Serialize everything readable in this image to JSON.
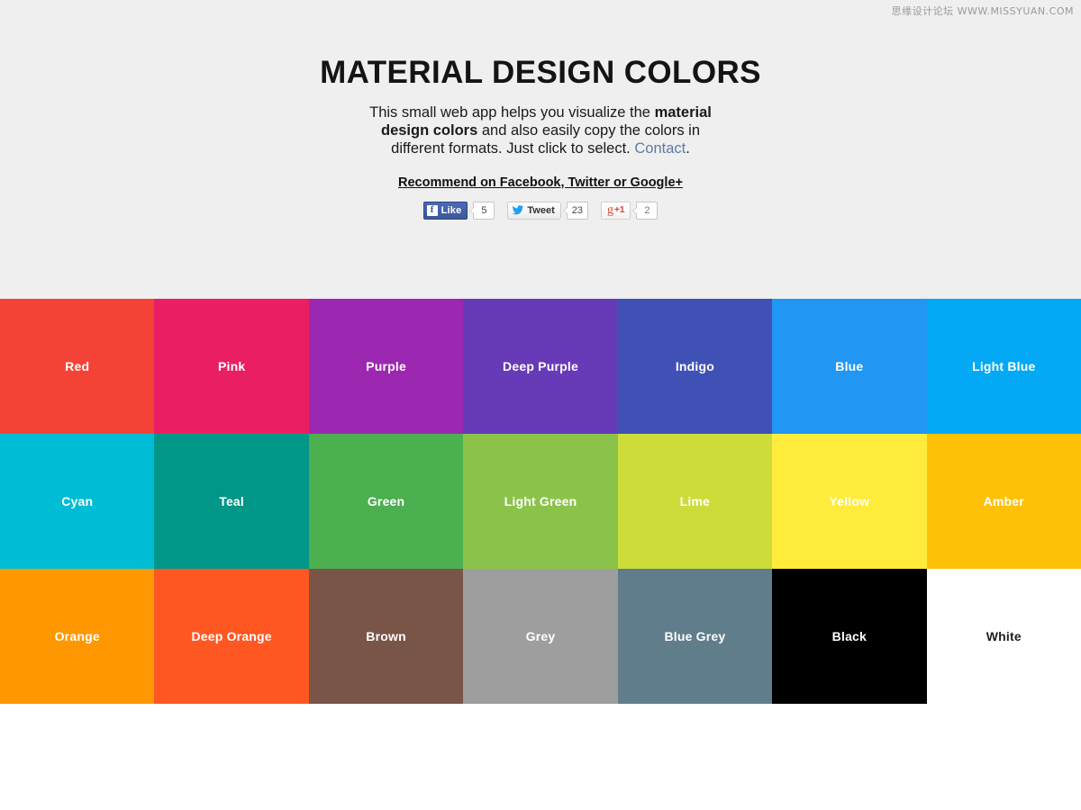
{
  "watermark": "思缘设计论坛  WWW.MISSYUAN.COM",
  "header": {
    "title": "MATERIAL DESIGN COLORS",
    "intro_line1": "This small web app helps you visualize the",
    "intro_bold": "material design colors",
    "intro_line2": " and also easily copy the",
    "intro_line3": "colors in different formats. Just click to select.",
    "contact_label": "Contact",
    "contact_period": ".",
    "recommend_label": "Recommend on Facebook, Twitter or Google+",
    "background_color": "#EFEFEF"
  },
  "social": {
    "facebook": {
      "icon": "facebook-f-icon",
      "label": "Like",
      "count": "5",
      "button_color": "#3B5998"
    },
    "twitter": {
      "icon": "twitter-bird-icon",
      "label": "Tweet",
      "count": "23",
      "icon_color": "#1DA1F2"
    },
    "googleplus": {
      "icon": "google-g-icon",
      "glyph": "g",
      "label": "+1",
      "count": "2",
      "text_color": "#D34836"
    }
  },
  "color_grid": {
    "columns": 7,
    "swatches": [
      {
        "name": "Red",
        "hex": "#F44336",
        "text_color": "#FFFFFF"
      },
      {
        "name": "Pink",
        "hex": "#E91E63",
        "text_color": "#FFFFFF"
      },
      {
        "name": "Purple",
        "hex": "#9C27B0",
        "text_color": "#FFFFFF"
      },
      {
        "name": "Deep Purple",
        "hex": "#673AB7",
        "text_color": "#FFFFFF"
      },
      {
        "name": "Indigo",
        "hex": "#3F51B5",
        "text_color": "#FFFFFF"
      },
      {
        "name": "Blue",
        "hex": "#2196F3",
        "text_color": "#FFFFFF"
      },
      {
        "name": "Light Blue",
        "hex": "#03A9F4",
        "text_color": "#FFFFFF"
      },
      {
        "name": "Cyan",
        "hex": "#00BCD4",
        "text_color": "#FFFFFF"
      },
      {
        "name": "Teal",
        "hex": "#009688",
        "text_color": "#FFFFFF"
      },
      {
        "name": "Green",
        "hex": "#4CAF50",
        "text_color": "#FFFFFF"
      },
      {
        "name": "Light Green",
        "hex": "#8BC34A",
        "text_color": "#FFFFFF"
      },
      {
        "name": "Lime",
        "hex": "#CDDC39",
        "text_color": "#FFFFFF"
      },
      {
        "name": "Yellow",
        "hex": "#FFEB3B",
        "text_color": "#FFFFFF"
      },
      {
        "name": "Amber",
        "hex": "#FFC107",
        "text_color": "#FFFFFF"
      },
      {
        "name": "Orange",
        "hex": "#FF9800",
        "text_color": "#FFFFFF"
      },
      {
        "name": "Deep Orange",
        "hex": "#FF5722",
        "text_color": "#FFFFFF"
      },
      {
        "name": "Brown",
        "hex": "#795548",
        "text_color": "#FFFFFF"
      },
      {
        "name": "Grey",
        "hex": "#9E9E9E",
        "text_color": "#FFFFFF"
      },
      {
        "name": "Blue Grey",
        "hex": "#607D8B",
        "text_color": "#FFFFFF"
      },
      {
        "name": "Black",
        "hex": "#000000",
        "text_color": "#FFFFFF"
      },
      {
        "name": "White",
        "hex": "#FFFFFF",
        "text_color": "#212121"
      }
    ]
  }
}
